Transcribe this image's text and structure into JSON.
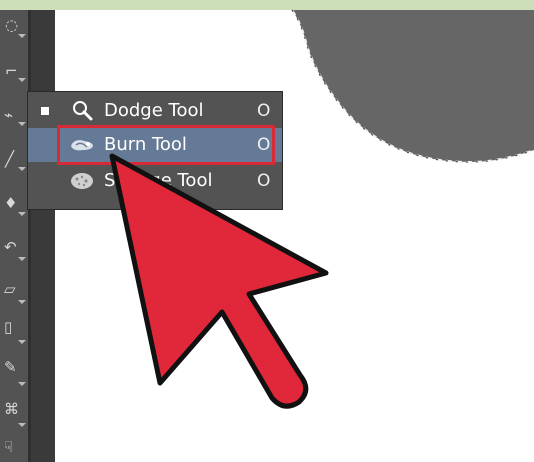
{
  "colors": {
    "top_band": "#cddfb8",
    "toolbar": "#535353",
    "selected_row": "#647a96",
    "highlight_red": "#d62b36",
    "arrow_red": "#e0283a",
    "canvas_shape": "#666666",
    "text_white": "#ffffff"
  },
  "toolbar": {
    "icons": [
      "lasso-icon",
      "crop-icon",
      "eyedropper-icon",
      "brush-icon",
      "clone-stamp-icon",
      "history-brush-icon",
      "eraser-icon",
      "gradient-icon",
      "dodge-icon",
      "pen-icon",
      "type-icon",
      "hand-icon"
    ]
  },
  "flyout": {
    "items": [
      {
        "label": "Dodge Tool",
        "shortcut": "O",
        "icon": "dodge-icon",
        "selected": false,
        "active": true
      },
      {
        "label": "Burn Tool",
        "shortcut": "O",
        "icon": "burn-icon",
        "selected": true,
        "active": false
      },
      {
        "label": "Sponge Tool",
        "shortcut": "O",
        "icon": "sponge-icon",
        "selected": false,
        "active": false
      }
    ]
  },
  "annotation": {
    "pointer": "arrow-pointer"
  }
}
